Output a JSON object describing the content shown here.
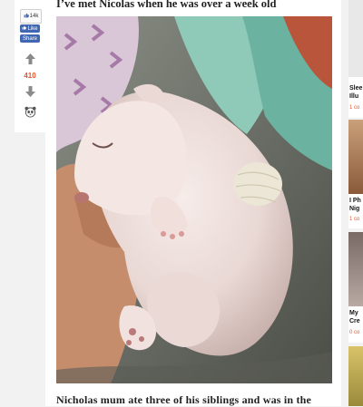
{
  "article": {
    "heading": "I’ve met Nicolas when he was over a week old",
    "caption": "Nicholas mum ate three of his siblings and was in the",
    "photo_subject": "sleeping white puppy with bandaged paw"
  },
  "share": {
    "count": "14k",
    "fb_like": "Like",
    "fb_share": "Share"
  },
  "votes": {
    "count": "410"
  },
  "sidebar": {
    "items": [
      {
        "title_line1": "Slee",
        "title_line2": "Illu",
        "comments": "1 co"
      },
      {
        "title_line1": "I Ph",
        "title_line2": "Nig",
        "comments": "1 co"
      },
      {
        "title_line1": "My",
        "title_line2": "Cre",
        "comments": "0 co"
      }
    ]
  },
  "colors": {
    "accent": "#e4572e",
    "facebook": "#4267b2",
    "background": "#f2f2f2"
  }
}
